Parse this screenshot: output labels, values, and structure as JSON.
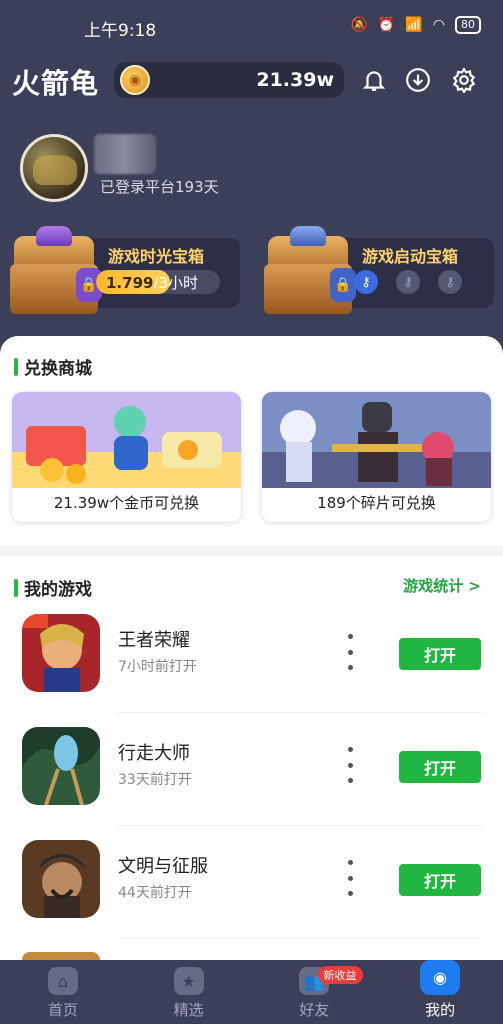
{
  "status_bar": {
    "time": "上午9:18",
    "battery": "80"
  },
  "header": {
    "app_title": "火箭龟",
    "coin_balance": "21.39w"
  },
  "profile": {
    "login_days_text": "已登录平台193天"
  },
  "chests": [
    {
      "title": "游戏时光宝箱",
      "progress_current": "1.799",
      "progress_rest": "/3小时",
      "progress_fraction": 0.6
    },
    {
      "title": "游戏启动宝箱",
      "keys_filled": 1,
      "keys_total": 3
    }
  ],
  "shop": {
    "title": "兑换商城",
    "cards": [
      {
        "label": "21.39w个金币可兑换"
      },
      {
        "label": "189个碎片可兑换"
      }
    ]
  },
  "my_games": {
    "title": "我的游戏",
    "stats_link": "游戏统计 >",
    "open_label": "打开",
    "items": [
      {
        "name": "王者荣耀",
        "last_opened": "7小时前打开"
      },
      {
        "name": "行走大师",
        "last_opened": "33天前打开"
      },
      {
        "name": "文明与征服",
        "last_opened": "44天前打开"
      }
    ]
  },
  "nav": {
    "items": [
      {
        "label": "首页"
      },
      {
        "label": "精选"
      },
      {
        "label": "好友",
        "badge": "新收益"
      },
      {
        "label": "我的"
      }
    ]
  },
  "colors": {
    "header_bg": "#3c3f58",
    "accent_green": "#20b641",
    "coin_gold": "#ffd36a"
  }
}
